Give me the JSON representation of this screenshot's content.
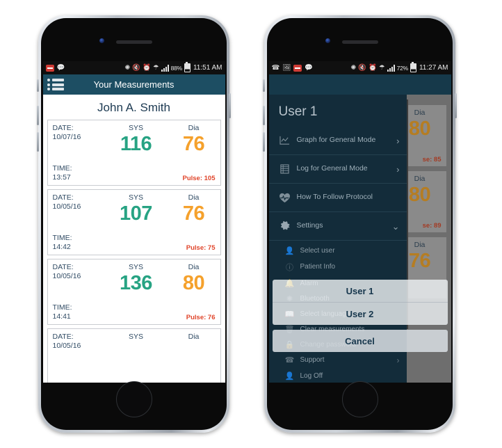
{
  "app": {
    "accent_teal": "#1d4e63",
    "sys_color": "#27a383",
    "dia_color": "#f5a12c",
    "pulse_color": "#e0452b"
  },
  "left_phone": {
    "statusbar": {
      "icons_left": [
        "message-red-icon",
        "chat-icon"
      ],
      "icons_right": [
        "bluetooth-icon",
        "mute-icon",
        "alarm-icon",
        "wifi-icon",
        "signal-icon"
      ],
      "battery_percent": "88%",
      "time": "11:51 AM"
    },
    "appbar": {
      "menu_icon": "list-menu-icon",
      "title": "Your Measurements"
    },
    "patient_name": "John A. Smith",
    "labels": {
      "date": "DATE:",
      "time": "TIME:",
      "sys": "SYS",
      "dia": "Dia"
    },
    "measurements": [
      {
        "date": "10/07/16",
        "time": "13:57",
        "sys": "116",
        "dia": "76",
        "pulse": "Pulse: 105"
      },
      {
        "date": "10/05/16",
        "time": "14:42",
        "sys": "107",
        "dia": "76",
        "pulse": "Pulse: 75"
      },
      {
        "date": "10/05/16",
        "time": "14:41",
        "sys": "136",
        "dia": "80",
        "pulse": "Pulse: 76"
      },
      {
        "date": "10/05/16",
        "time": "",
        "sys": "",
        "dia": "",
        "pulse": ""
      }
    ]
  },
  "right_phone": {
    "statusbar": {
      "icons_left": [
        "phone-icon",
        "image-icon",
        "message-red-icon",
        "chat-icon"
      ],
      "icons_right": [
        "bluetooth-icon",
        "mute-icon",
        "alarm-icon",
        "wifi-icon",
        "signal-icon"
      ],
      "battery_percent": "72%",
      "time": "11:27 AM"
    },
    "appbar": {
      "menu_icon": "list-menu-icon"
    },
    "drawer": {
      "user_title": "User 1",
      "items": [
        {
          "label": "Graph for General Mode",
          "icon": "chart-icon",
          "chevron": "›"
        },
        {
          "label": "Log for General Mode",
          "icon": "log-icon",
          "chevron": "›"
        },
        {
          "label": "How To Follow Protocol",
          "icon": "heart-pulse-icon",
          "chevron": ""
        },
        {
          "label": "Settings",
          "icon": "gear-icon",
          "chevron": "⌄"
        }
      ],
      "settings_items": [
        {
          "label": "Select user",
          "icon": "user-icon"
        },
        {
          "label": "Patient Info",
          "icon": "info-icon"
        },
        {
          "label": "Alarm",
          "icon": "alarm-icon"
        },
        {
          "label": "Bluetooth",
          "icon": "bluetooth-icon"
        },
        {
          "label": "Select language",
          "icon": "book-icon"
        },
        {
          "label": "Clear measurements",
          "icon": "trash-icon"
        },
        {
          "label": "Change password",
          "icon": "lock-icon"
        },
        {
          "label": "Support",
          "icon": "phone-call-icon"
        },
        {
          "label": "Log Off",
          "icon": "user-icon"
        }
      ]
    },
    "dialog": {
      "options": [
        "User 1",
        "User 2"
      ],
      "cancel": "Cancel"
    },
    "background_cards": [
      {
        "dia_label": "Dia",
        "dia": "80",
        "pulse": "se: 85"
      },
      {
        "dia_label": "Dia",
        "dia": "80",
        "pulse": "se: 89"
      },
      {
        "dia_label": "Dia",
        "dia": "76",
        "pulse": ""
      }
    ]
  }
}
